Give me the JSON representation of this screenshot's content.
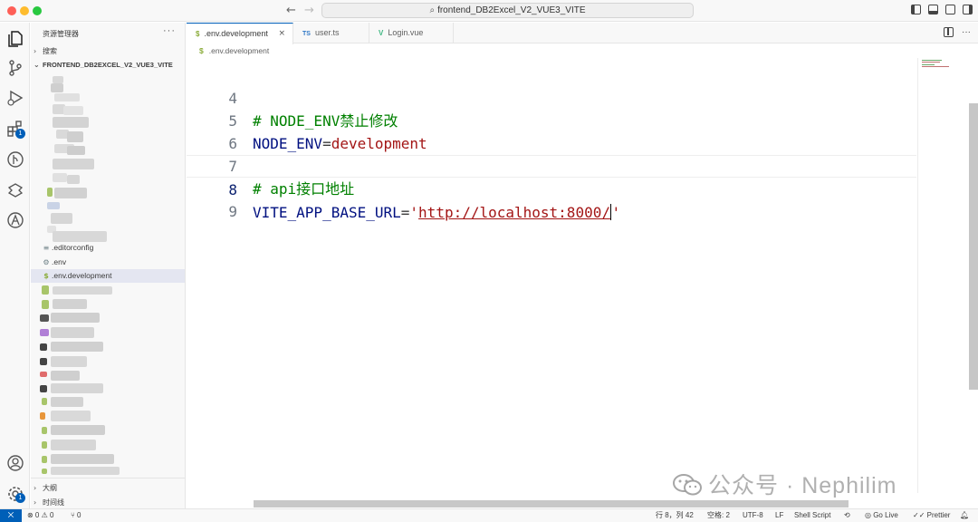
{
  "titlebar": {
    "command_center": "frontend_DB2Excel_V2_VUE3_VITE",
    "back_icon": "arrow-left-icon",
    "forward_icon": "arrow-right-icon"
  },
  "activity_bar": {
    "items": [
      "explorer-icon",
      "source-control-icon",
      "run-debug-icon",
      "extensions-icon",
      "gitlens-icon",
      "tailwind-icon",
      "anthropic-icon"
    ],
    "extensions_badge": "1",
    "settings_badge": "1"
  },
  "sidebar": {
    "title": "资源管理器",
    "more": "···",
    "search_section": "搜索",
    "project_name": "FRONTEND_DB2EXCEL_V2_VUE3_VITE",
    "files": [
      {
        "name": ".editorconfig",
        "icon": "≡",
        "icon_color": "#6d8086"
      },
      {
        "name": ".env",
        "icon": "⚙",
        "icon_color": "#6d8086"
      },
      {
        "name": ".env.development",
        "icon": "$",
        "icon_color": "#8bac3a",
        "selected": true
      }
    ],
    "outline_section": "大纲",
    "timeline_section": "时间线"
  },
  "tabs": [
    {
      "label": ".env.development",
      "icon": "$",
      "icon_color": "#8bac3a",
      "active": true,
      "close": "×"
    },
    {
      "label": "user.ts",
      "icon": "TS",
      "icon_color": "#3178c6",
      "active": false
    },
    {
      "label": "Login.vue",
      "icon": "V",
      "icon_color": "#41b883",
      "active": false
    }
  ],
  "breadcrumb": {
    "icon": "$",
    "label": ".env.development"
  },
  "editor": {
    "lines": [
      {
        "number": "4",
        "comment": "# NODE_ENV禁止修改"
      },
      {
        "number": "5",
        "key": "NODE_ENV",
        "op": "=",
        "value": "development"
      },
      {
        "number": "6"
      },
      {
        "number": "7",
        "comment": "# api接口地址"
      },
      {
        "number": "8",
        "key": "VITE_APP_BASE_URL",
        "op": "=",
        "quote": "'",
        "url": "http://localhost:8000/",
        "quote_end": "'"
      },
      {
        "number": "9"
      }
    ]
  },
  "statusbar": {
    "remote_icon": "remote-icon",
    "problems": "⊗ 0 ⚠ 0",
    "ports": "⑂ 0",
    "position": "行 8，列 42",
    "spaces": "空格: 2",
    "encoding": "UTF-8",
    "eol": "LF",
    "language": "Shell Script",
    "golive": "Go Live",
    "prettier": "Prettier"
  },
  "watermark": {
    "text": "公众号 · Nephilim"
  }
}
